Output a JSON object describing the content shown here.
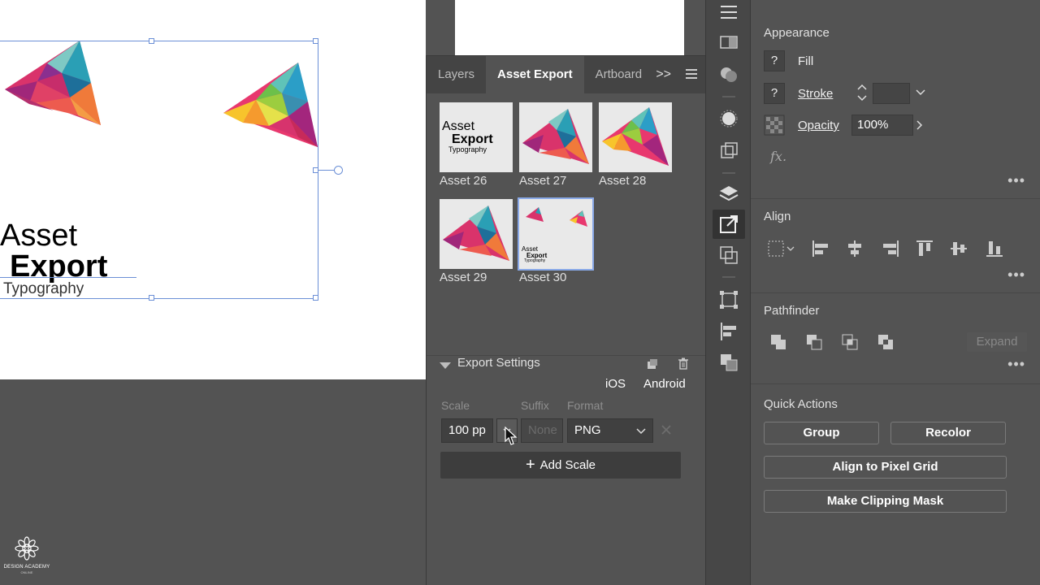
{
  "panel": {
    "tabs": [
      "Layers",
      "Asset Export",
      "Artboard"
    ],
    "overflow_label": ">>",
    "assets": [
      {
        "label": "Asset 26",
        "kind": "text"
      },
      {
        "label": "Asset 27",
        "kind": "tri-pink"
      },
      {
        "label": "Asset 28",
        "kind": "tri-yellow"
      },
      {
        "label": "Asset 29",
        "kind": "tri-pink"
      },
      {
        "label": "Asset 30",
        "kind": "composite",
        "selected": true
      }
    ],
    "export_settings": {
      "title": "Export Settings",
      "platforms": [
        "iOS",
        "Android"
      ],
      "columns": {
        "scale": "Scale",
        "suffix": "Suffix",
        "format": "Format"
      },
      "scale_value": "100 pp",
      "suffix_placeholder": "None",
      "format_value": "PNG",
      "add_scale_label": "Add Scale"
    }
  },
  "artboard_text": {
    "line1": "Asset",
    "line2": "Export",
    "line3": "Typography"
  },
  "thumb_text": {
    "line1": "Asset",
    "line2": "Export",
    "line3": "Typography"
  },
  "properties": {
    "appearance": {
      "title": "Appearance",
      "fill_label": "Fill",
      "stroke_label": "Stroke",
      "opacity_label": "Opacity",
      "opacity_value": "100%",
      "fx_label": "fx."
    },
    "align": {
      "title": "Align"
    },
    "pathfinder": {
      "title": "Pathfinder",
      "expand_label": "Expand"
    },
    "quick_actions": {
      "title": "Quick Actions",
      "buttons": [
        "Group",
        "Recolor",
        "Align to Pixel Grid",
        "Make Clipping Mask"
      ]
    },
    "unknown_symbol": "?"
  },
  "logo": {
    "line1": "DESIGN ACADEMY",
    "line2": "ONLINE"
  }
}
